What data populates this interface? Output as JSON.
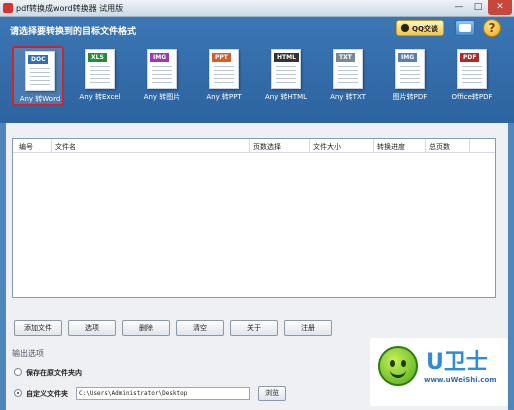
{
  "window": {
    "title": "pdf转换成word转换器 试用版",
    "min": "—",
    "max": "□",
    "close": "✕"
  },
  "header": {
    "heading": "请选择要转换到的目标文件格式",
    "qq_label": "QQ交谈",
    "help_glyph": "?"
  },
  "tiles": [
    {
      "tag": "DOC",
      "label": "Any 转Word",
      "color": "#2f6fb5",
      "selected": true
    },
    {
      "tag": "XLS",
      "label": "Any 转Excel",
      "color": "#2a8a3c",
      "selected": false
    },
    {
      "tag": "IMG",
      "label": "Any 转图片",
      "color": "#9a3bb0",
      "selected": false
    },
    {
      "tag": "PPT",
      "label": "Any 转PPT",
      "color": "#d2602a",
      "selected": false
    },
    {
      "tag": "HTML",
      "label": "Any 转HTML",
      "color": "#333333",
      "selected": false
    },
    {
      "tag": "TXT",
      "label": "Any 转TXT",
      "color": "#7a8896",
      "selected": false
    },
    {
      "tag": "IMG",
      "label": "图片转PDF",
      "color": "#5a7fa8",
      "selected": false
    },
    {
      "tag": "PDF",
      "label": "Office转PDF",
      "color": "#b02a2a",
      "selected": false
    }
  ],
  "table": {
    "columns": [
      "编号",
      "文件名",
      "页数选择",
      "文件大小",
      "转换进度",
      "总页数"
    ]
  },
  "buttons": {
    "add": "添加文件",
    "options": "选项",
    "delete": "删除",
    "clear": "清空",
    "about": "关于",
    "register": "注册",
    "browse": "浏览"
  },
  "output": {
    "title": "输出选项",
    "keep_original": "保存在原文件夹内",
    "custom_folder": "自定义文件夹",
    "path": "C:\\Users\\Administrator\\Desktop"
  },
  "watermark": {
    "logo": "U卫士",
    "url": "www.uWeiShi.com"
  }
}
